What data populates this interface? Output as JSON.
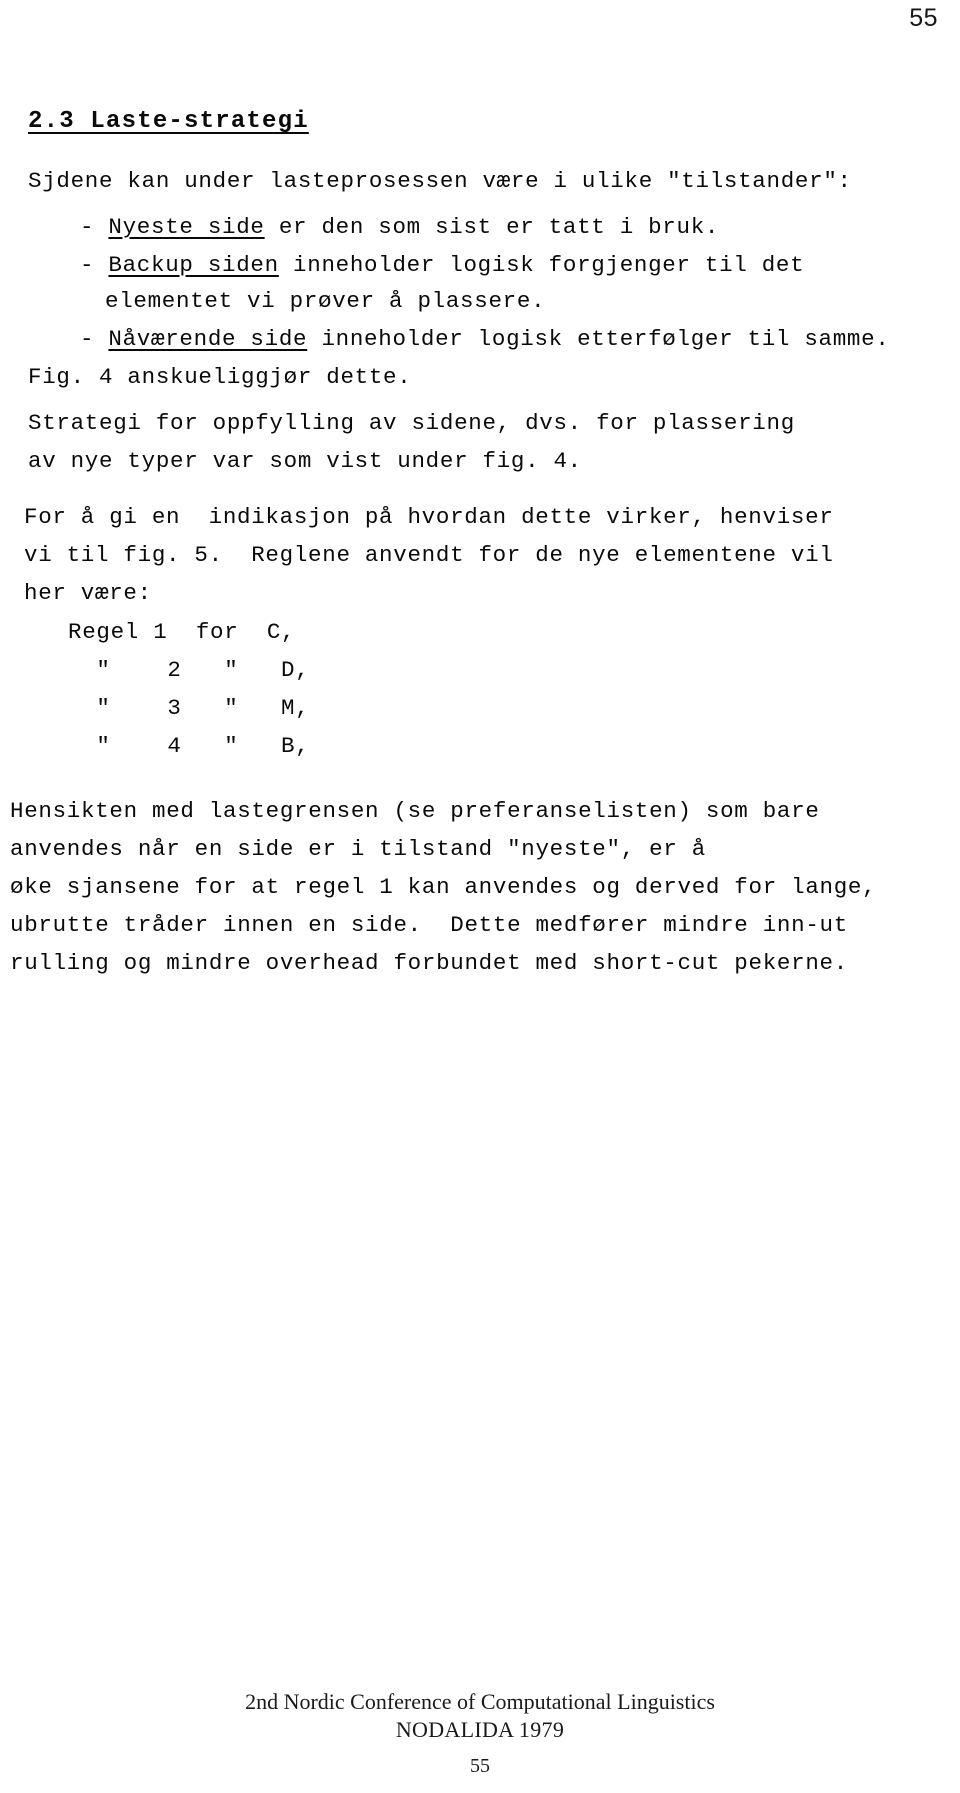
{
  "page": {
    "number_top": "55",
    "number_bottom": "55"
  },
  "heading": {
    "text": "2.3 Laste-strategi"
  },
  "intro": {
    "text": "Sjdene kan under lasteprosessen være i ulike \"tilstander\":"
  },
  "bullets": [
    {
      "dash": "-",
      "term": "Nyeste side",
      "rest": " er den som sist er tatt i bruk."
    },
    {
      "dash": "-",
      "term": "Backup siden",
      "rest": " inneholder logisk forgjenger til det",
      "continuation": "elementet vi prøver å plassere."
    },
    {
      "dash": "-",
      "term": "Nåværende side",
      "rest": " inneholder logisk etterfølger til samme."
    }
  ],
  "paragraphs": {
    "fig": "Fig. 4 anskueliggjør dette.",
    "strategy_line1": "Strategi for oppfylling av sidene, dvs. for plassering",
    "strategy_line2": "av nye typer var som vist under fig. 4.",
    "reference_line1": "For å gi en  indikasjon på hvordan dette virker, henviser",
    "reference_line2": "vi til fig. 5.  Reglene anvendt for de nye elementene vil",
    "reference_line3": "her være:"
  },
  "rules": [
    "Regel 1  for  C,",
    "  \"    2   \"   D,",
    "  \"    3   \"   M,",
    "  \"    4   \"   B,"
  ],
  "closing": {
    "line1": "Hensikten med lastegrensen (se preferanselisten) som bare",
    "line2": "anvendes når en side er i tilstand \"nyeste\", er å",
    "line3": "øke sjansene for at regel 1 kan anvendes og derved for lange,",
    "line4": "ubrutte tråder innen en side.  Dette medfører mindre inn-ut",
    "line5": "rulling og mindre overhead forbundet med short-cut pekerne."
  },
  "footer": {
    "conference": "2nd Nordic Conference of Computational Linguistics",
    "event": "NODALIDA 1979"
  }
}
